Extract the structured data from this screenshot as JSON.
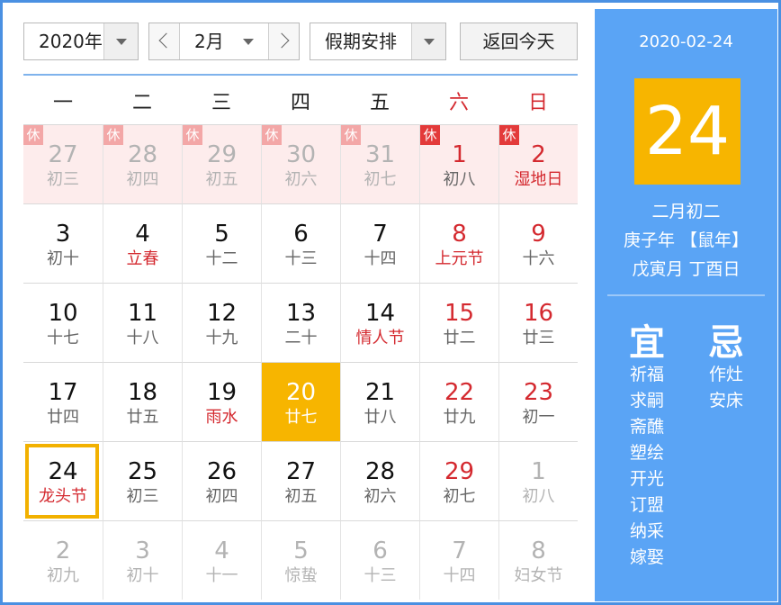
{
  "toolbar": {
    "year": "2020年",
    "month": "2月",
    "holiday": "假期安排",
    "today_button": "返回今天"
  },
  "weekdays": [
    "一",
    "二",
    "三",
    "四",
    "五",
    "六",
    "日"
  ],
  "holiday_badge": "休",
  "cells": [
    {
      "day": "27",
      "lunar": "初三",
      "dim": true,
      "hol": true,
      "badge": "light"
    },
    {
      "day": "28",
      "lunar": "初四",
      "dim": true,
      "hol": true,
      "badge": "light"
    },
    {
      "day": "29",
      "lunar": "初五",
      "dim": true,
      "hol": true,
      "badge": "light"
    },
    {
      "day": "30",
      "lunar": "初六",
      "dim": true,
      "hol": true,
      "badge": "light"
    },
    {
      "day": "31",
      "lunar": "初七",
      "dim": true,
      "hol": true,
      "badge": "light"
    },
    {
      "day": "1",
      "lunar": "初八",
      "red": true,
      "hol": true,
      "badge": "dark"
    },
    {
      "day": "2",
      "lunar": "湿地日",
      "red": true,
      "lunred": true,
      "hol": true,
      "badge": "dark"
    },
    {
      "day": "3",
      "lunar": "初十"
    },
    {
      "day": "4",
      "lunar": "立春",
      "lunred": true
    },
    {
      "day": "5",
      "lunar": "十二"
    },
    {
      "day": "6",
      "lunar": "十三"
    },
    {
      "day": "7",
      "lunar": "十四"
    },
    {
      "day": "8",
      "lunar": "上元节",
      "red": true,
      "lunred": true
    },
    {
      "day": "9",
      "lunar": "十六",
      "red": true
    },
    {
      "day": "10",
      "lunar": "十七"
    },
    {
      "day": "11",
      "lunar": "十八"
    },
    {
      "day": "12",
      "lunar": "十九"
    },
    {
      "day": "13",
      "lunar": "二十"
    },
    {
      "day": "14",
      "lunar": "情人节",
      "lunred": true
    },
    {
      "day": "15",
      "lunar": "廿二",
      "red": true
    },
    {
      "day": "16",
      "lunar": "廿三",
      "red": true
    },
    {
      "day": "17",
      "lunar": "廿四"
    },
    {
      "day": "18",
      "lunar": "廿五"
    },
    {
      "day": "19",
      "lunar": "雨水",
      "lunred": true
    },
    {
      "day": "20",
      "lunar": "廿七",
      "sel": true
    },
    {
      "day": "21",
      "lunar": "廿八"
    },
    {
      "day": "22",
      "lunar": "廿九",
      "red": true
    },
    {
      "day": "23",
      "lunar": "初一",
      "red": true
    },
    {
      "day": "24",
      "lunar": "龙头节",
      "lunred": true,
      "today": true
    },
    {
      "day": "25",
      "lunar": "初三"
    },
    {
      "day": "26",
      "lunar": "初四"
    },
    {
      "day": "27",
      "lunar": "初五"
    },
    {
      "day": "28",
      "lunar": "初六"
    },
    {
      "day": "29",
      "lunar": "初七",
      "red": true
    },
    {
      "day": "1",
      "lunar": "初八",
      "dim": true
    },
    {
      "day": "2",
      "lunar": "初九",
      "dim": true
    },
    {
      "day": "3",
      "lunar": "初十",
      "dim": true
    },
    {
      "day": "4",
      "lunar": "十一",
      "dim": true
    },
    {
      "day": "5",
      "lunar": "惊蛰",
      "dim": true
    },
    {
      "day": "6",
      "lunar": "十三",
      "dim": true
    },
    {
      "day": "7",
      "lunar": "十四",
      "dim": true
    },
    {
      "day": "8",
      "lunar": "妇女节",
      "dim": true
    }
  ],
  "side": {
    "date": "2020-02-24",
    "big_day": "24",
    "lunar_date": "二月初二",
    "year_line": "庚子年 【鼠年】",
    "month_day_line": "戊寅月 丁酉日",
    "yi_title": "宜",
    "ji_title": "忌",
    "yi_items": [
      "祈福",
      "求嗣",
      "斋醮",
      "塑绘",
      "开光",
      "订盟",
      "纳采",
      "嫁娶"
    ],
    "ji_items": [
      "作灶",
      "安床"
    ]
  },
  "colors": {
    "accent_blue": "#5aa4f5",
    "selected_gold": "#f7b500",
    "holiday_red": "#d4292f",
    "holiday_bg": "#fdecec"
  }
}
